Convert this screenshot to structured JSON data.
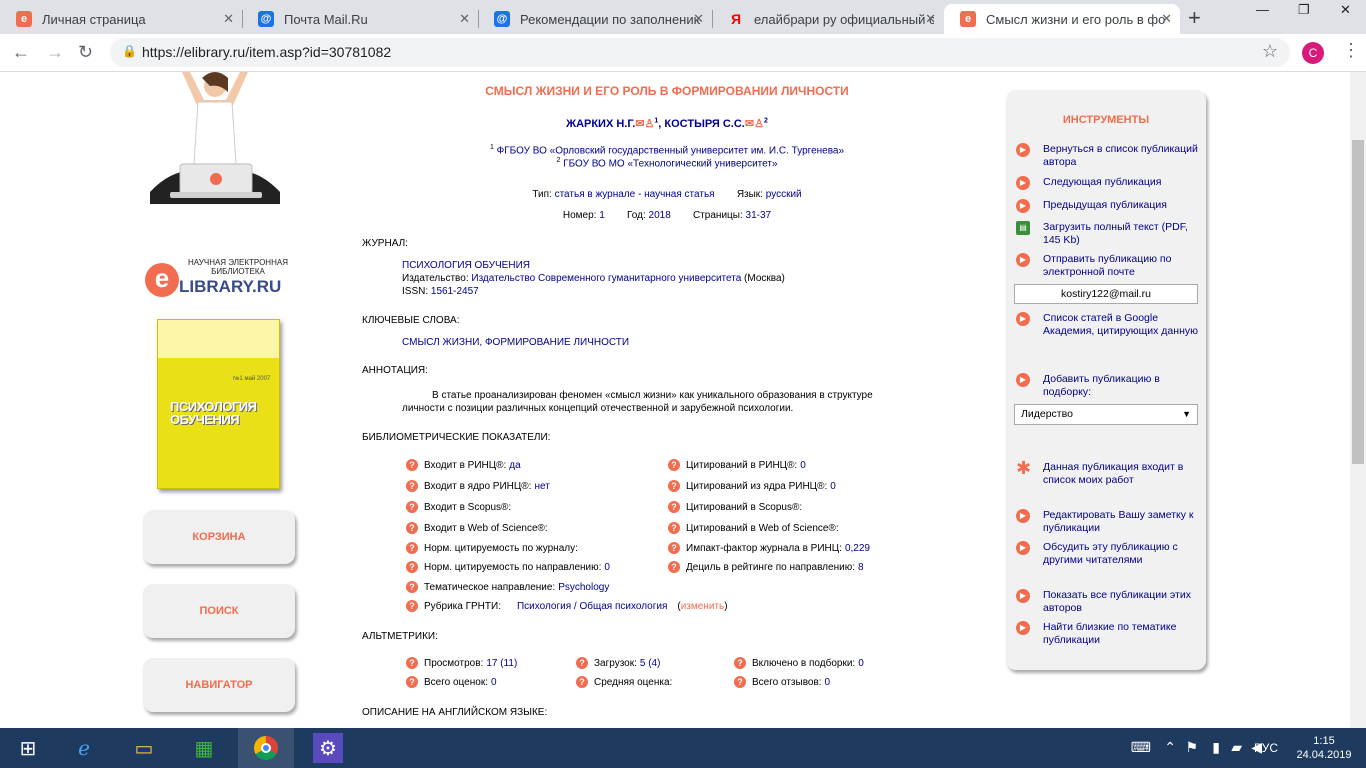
{
  "browser": {
    "tabs": [
      {
        "title": "Личная страница",
        "fav": "e",
        "color": "#f26c4f"
      },
      {
        "title": "Почта Mail.Ru",
        "fav": "@",
        "color": "#1a73e8"
      },
      {
        "title": "Рекомендации по заполнению",
        "fav": "@",
        "color": "#1a73e8"
      },
      {
        "title": "елайбрари ру официальный са",
        "fav": "Я",
        "color": "#ff0000"
      },
      {
        "title": "Смысл жизни и его роль в фор",
        "fav": "e",
        "color": "#f26c4f"
      }
    ],
    "url": "https://elibrary.ru/item.asp?id=30781082",
    "profile": "C"
  },
  "left": {
    "logo_line1": "НАУЧНАЯ ЭЛЕКТРОННАЯ",
    "logo_line2": "БИБЛИОТЕКА",
    "logo_name": "LIBRARY.RU",
    "cover_title_1": "ПСИХОЛОГИЯ",
    "cover_title_2": "ОБУЧЕНИЯ",
    "cover_issue": "№1 май 2007",
    "buttons": [
      "КОРЗИНА",
      "ПОИСК",
      "НАВИГАТОР"
    ]
  },
  "article": {
    "title": "СМЫСЛ ЖИЗНИ И ЕГО РОЛЬ В ФОРМИРОВАНИИ ЛИЧНОСТИ",
    "author1": "ЖАРКИХ Н.Г.",
    "author1_sup": "1",
    "author2": "КОСТЫРЯ С.С.",
    "author2_sup": "2",
    "aff1_sup": "1",
    "aff1": "ФГБОУ ВО «Орловский государственный университет им. И.С. Тургенева»",
    "aff2_sup": "2",
    "aff2": "ГБОУ ВО МО «Технологический университет»",
    "type_label": "Тип:",
    "type_value": "статья в журнале - научная статья",
    "lang_label": "Язык:",
    "lang_value": "русский",
    "num_label": "Номер:",
    "num_value": "1",
    "year_label": "Год:",
    "year_value": "2018",
    "pages_label": "Страницы:",
    "pages_value": "31-37",
    "journal_hd": "ЖУРНАЛ:",
    "journal_name": "ПСИХОЛОГИЯ ОБУЧЕНИЯ",
    "publisher_label": "Издательство:",
    "publisher_value": "Издательство Современного гуманитарного университета",
    "publisher_city": "(Москва)",
    "issn_label": "ISSN:",
    "issn_value": "1561-2457",
    "kw_hd": "КЛЮЧЕВЫЕ СЛОВА:",
    "kw_value": "СМЫСЛ ЖИЗНИ, ФОРМИРОВАНИЕ ЛИЧНОСТИ",
    "ann_hd": "АННОТАЦИЯ:",
    "ann_1": "В статье проанализирован феномен «смысл жизни» как уникального образования в структуре",
    "ann_2": "личности с позиции различных концепций отечественной и зарубежной психологии.",
    "bib_hd": "БИБЛИОМЕТРИЧЕСКИЕ ПОКАЗАТЕЛИ:",
    "bib_left": [
      {
        "label": "Входит в РИНЦ®:",
        "value": "да"
      },
      {
        "label": "Входит в ядро РИНЦ®:",
        "value": "нет"
      },
      {
        "label": "Входит в Scopus®:",
        "value": ""
      },
      {
        "label": "Входит в Web of Science®:",
        "value": ""
      },
      {
        "label": "Норм. цитируемость по журналу:",
        "value": ""
      },
      {
        "label": "Норм. цитируемость по направлению:",
        "value": "0"
      },
      {
        "label": "Тематическое направление:",
        "value": "Psychology"
      },
      {
        "label": "Рубрика ГРНТИ:",
        "value": "Психология / Общая психология"
      }
    ],
    "grnti_edit": "изменить",
    "bib_right": [
      {
        "label": "Цитирований в РИНЦ®:",
        "value": "0"
      },
      {
        "label": "Цитирований из ядра РИНЦ®:",
        "value": "0"
      },
      {
        "label": "Цитирований в Scopus®:",
        "value": ""
      },
      {
        "label": "Цитирований в Web of Science®:",
        "value": ""
      },
      {
        "label": "Импакт-фактор журнала в РИНЦ:",
        "value": "0,229"
      },
      {
        "label": "Дециль в рейтинге по направлению:",
        "value": "8"
      }
    ],
    "alt_hd": "АЛЬТМЕТРИКИ:",
    "alt": [
      {
        "label": "Просмотров:",
        "value": "17 (11)"
      },
      {
        "label": "Загрузок:",
        "value": "5 (4)"
      },
      {
        "label": "Включено в подборки:",
        "value": "0"
      },
      {
        "label": "Всего оценок:",
        "value": "0"
      },
      {
        "label": "Средняя оценка:",
        "value": ""
      },
      {
        "label": "Всего отзывов:",
        "value": "0"
      }
    ],
    "eng_hd": "ОПИСАНИЕ НА АНГЛИЙСКОМ ЯЗЫКЕ:"
  },
  "tools": {
    "heading": "ИНСТРУМЕНТЫ",
    "items": [
      "Вернуться в список публикаций автора",
      "Следующая публикация",
      "Предыдущая публикация",
      "Загрузить полный текст (PDF, 145 Kb)",
      "Отправить публикацию по электронной почте",
      "Список статей в Google Академия, цитирующих данную",
      "Добавить публикацию в подборку:",
      "Данная публикация входит в список моих работ",
      "Редактировать Вашу заметку к публикации",
      "Обсудить эту публикацию с другими читателями",
      "Показать все публикации этих авторов",
      "Найти близкие по тематике публикации"
    ],
    "email_value": "kostiry122@mail.ru",
    "collection_value": "Лидерство"
  },
  "taskbar": {
    "lang": "РУС",
    "time": "1:15",
    "date": "24.04.2019"
  }
}
